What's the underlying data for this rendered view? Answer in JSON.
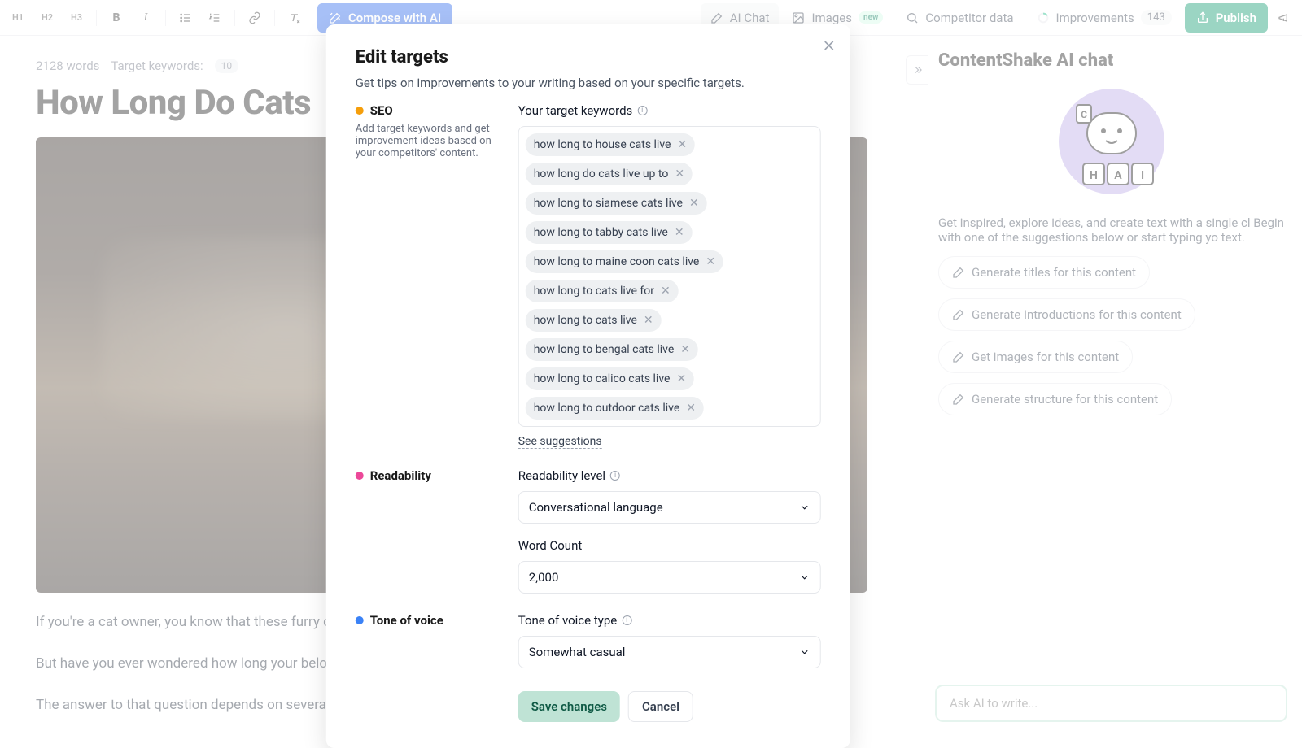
{
  "toolbar": {
    "h1": "H1",
    "h2": "H2",
    "h3": "H3",
    "bold": "B",
    "italic": "I",
    "compose": "Compose with AI",
    "ai_chat": "AI Chat",
    "images": "Images",
    "images_badge": "new",
    "competitor": "Competitor data",
    "improvements": "Improvements",
    "improvements_count": "143",
    "publish": "Publish"
  },
  "editor": {
    "words": "2128 words",
    "target_label": "Target keywords:",
    "target_count": "10",
    "title": "How Long Do Cats",
    "p1": "If you're a cat owner, you know that these furry creature",
    "p2": "But have you ever wondered how long your beloved felin",
    "p3": "The answer to that question depends on several factors,"
  },
  "right": {
    "title": "ContentShake AI chat",
    "desc": "Get inspired, explore ideas, and create text with a single cl Begin with one of the suggestions below or start typing yo text.",
    "suggestions": [
      "Generate titles for this content",
      "Generate Introductions for this content",
      "Get images for this content",
      "Generate structure for this content"
    ],
    "input_placeholder": "Ask AI to write..."
  },
  "modal": {
    "title": "Edit targets",
    "subtitle": "Get tips on improvements to your writing based on your specific targets.",
    "seo_label": "SEO",
    "seo_help": "Add target keywords and get improvement ideas based on your competitors' content.",
    "keywords_label": "Your target keywords",
    "keywords": [
      "how long to house cats live",
      "how long do cats live up to",
      "how long to siamese cats live",
      "how long to tabby cats live",
      "how long to maine coon cats live",
      "how long to cats live for",
      "how long to cats live",
      "how long to bengal cats live",
      "how long to calico cats live",
      "how long to outdoor cats live"
    ],
    "see_suggestions": "See suggestions",
    "readability_label": "Readability",
    "readability_level_label": "Readability level",
    "readability_value": "Conversational language",
    "word_count_label": "Word Count",
    "word_count_value": "2,000",
    "tone_label": "Tone of voice",
    "tone_type_label": "Tone of voice type",
    "tone_value": "Somewhat casual",
    "save": "Save changes",
    "cancel": "Cancel"
  }
}
